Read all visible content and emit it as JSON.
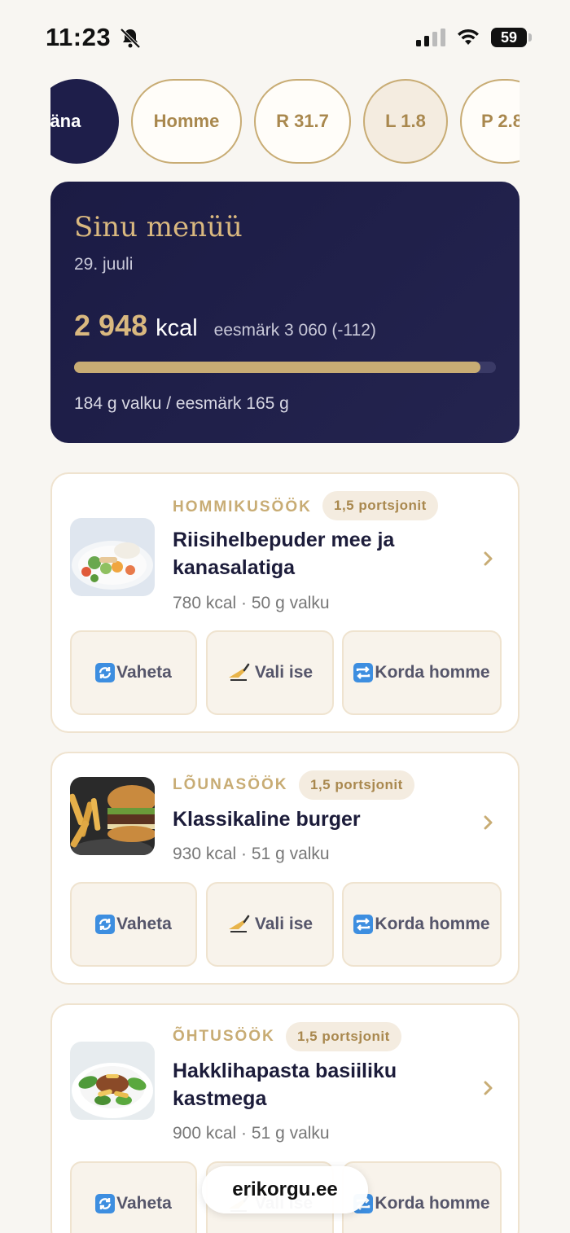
{
  "status": {
    "time": "11:23",
    "battery": "59"
  },
  "days": [
    {
      "label": "Täna",
      "state": "active"
    },
    {
      "label": "Homme",
      "state": "normal"
    },
    {
      "label": "R 31.7",
      "state": "normal"
    },
    {
      "label": "L 1.8",
      "state": "tinted"
    },
    {
      "label": "P 2.8",
      "state": "normal"
    }
  ],
  "summary": {
    "title": "Sinu menüü",
    "date": "29. juuli",
    "kcal": "2 948",
    "kcal_unit": "kcal",
    "goal": "eesmärk 3 060 (-112)",
    "progress_fraction": 0.963,
    "protein": "184 g valku / eesmärk 165 g"
  },
  "meals": [
    {
      "type": "HOMMIKUSÖÖK",
      "portion": "1,5 portsjonit",
      "name": "Riisihelbepuder mee ja kanasalatiga",
      "meta": "780 kcal · 50 g valku",
      "image": "salad-plate-photo"
    },
    {
      "type": "LÕUNASÖÖK",
      "portion": "1,5 portsjonit",
      "name": "Klassikaline burger",
      "meta": "930 kcal · 51 g valku",
      "image": "burger-fries-photo"
    },
    {
      "type": "ÕHTUSÖÖK",
      "portion": "1,5 portsjonit",
      "name": "Hakklihapasta basiiliku kastmega",
      "meta": "900 kcal · 51 g valku",
      "image": "pasta-bowl-photo"
    }
  ],
  "actions": {
    "swap": "Vaheta",
    "choose": "Vali ise",
    "repeat": "Korda homme"
  },
  "url": "erikorgu.ee",
  "colors": {
    "navy": "#1e1e4a",
    "gold": "#c8ac74",
    "cream": "#f8f3eb"
  }
}
